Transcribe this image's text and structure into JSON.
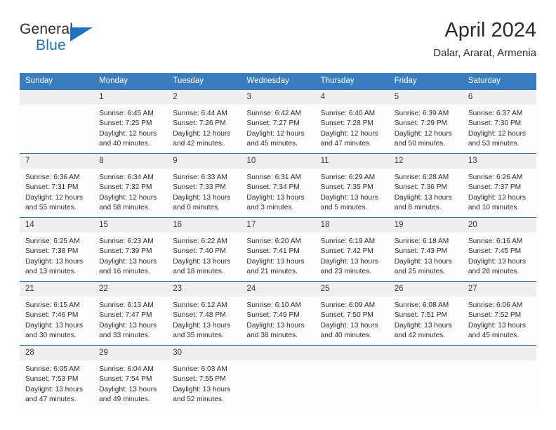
{
  "brand": {
    "word1": "General",
    "word2": "Blue",
    "flag_icon": "triangle-flag-icon",
    "color_primary": "#1f72bd",
    "color_text": "#2b2b2b"
  },
  "header": {
    "month_title": "April 2024",
    "location": "Dalar, Ararat, Armenia"
  },
  "calendar": {
    "accent_color": "#3A7DBF",
    "daynum_bg": "#efefef",
    "weekday_headers": [
      "Sunday",
      "Monday",
      "Tuesday",
      "Wednesday",
      "Thursday",
      "Friday",
      "Saturday"
    ],
    "weeks": [
      [
        {
          "day": "",
          "sunrise": "",
          "sunset": "",
          "daylight_line1": "",
          "daylight_line2": ""
        },
        {
          "day": "1",
          "sunrise": "Sunrise: 6:45 AM",
          "sunset": "Sunset: 7:25 PM",
          "daylight_line1": "Daylight: 12 hours",
          "daylight_line2": "and 40 minutes."
        },
        {
          "day": "2",
          "sunrise": "Sunrise: 6:44 AM",
          "sunset": "Sunset: 7:26 PM",
          "daylight_line1": "Daylight: 12 hours",
          "daylight_line2": "and 42 minutes."
        },
        {
          "day": "3",
          "sunrise": "Sunrise: 6:42 AM",
          "sunset": "Sunset: 7:27 PM",
          "daylight_line1": "Daylight: 12 hours",
          "daylight_line2": "and 45 minutes."
        },
        {
          "day": "4",
          "sunrise": "Sunrise: 6:40 AM",
          "sunset": "Sunset: 7:28 PM",
          "daylight_line1": "Daylight: 12 hours",
          "daylight_line2": "and 47 minutes."
        },
        {
          "day": "5",
          "sunrise": "Sunrise: 6:39 AM",
          "sunset": "Sunset: 7:29 PM",
          "daylight_line1": "Daylight: 12 hours",
          "daylight_line2": "and 50 minutes."
        },
        {
          "day": "6",
          "sunrise": "Sunrise: 6:37 AM",
          "sunset": "Sunset: 7:30 PM",
          "daylight_line1": "Daylight: 12 hours",
          "daylight_line2": "and 53 minutes."
        }
      ],
      [
        {
          "day": "7",
          "sunrise": "Sunrise: 6:36 AM",
          "sunset": "Sunset: 7:31 PM",
          "daylight_line1": "Daylight: 12 hours",
          "daylight_line2": "and 55 minutes."
        },
        {
          "day": "8",
          "sunrise": "Sunrise: 6:34 AM",
          "sunset": "Sunset: 7:32 PM",
          "daylight_line1": "Daylight: 12 hours",
          "daylight_line2": "and 58 minutes."
        },
        {
          "day": "9",
          "sunrise": "Sunrise: 6:33 AM",
          "sunset": "Sunset: 7:33 PM",
          "daylight_line1": "Daylight: 13 hours",
          "daylight_line2": "and 0 minutes."
        },
        {
          "day": "10",
          "sunrise": "Sunrise: 6:31 AM",
          "sunset": "Sunset: 7:34 PM",
          "daylight_line1": "Daylight: 13 hours",
          "daylight_line2": "and 3 minutes."
        },
        {
          "day": "11",
          "sunrise": "Sunrise: 6:29 AM",
          "sunset": "Sunset: 7:35 PM",
          "daylight_line1": "Daylight: 13 hours",
          "daylight_line2": "and 5 minutes."
        },
        {
          "day": "12",
          "sunrise": "Sunrise: 6:28 AM",
          "sunset": "Sunset: 7:36 PM",
          "daylight_line1": "Daylight: 13 hours",
          "daylight_line2": "and 8 minutes."
        },
        {
          "day": "13",
          "sunrise": "Sunrise: 6:26 AM",
          "sunset": "Sunset: 7:37 PM",
          "daylight_line1": "Daylight: 13 hours",
          "daylight_line2": "and 10 minutes."
        }
      ],
      [
        {
          "day": "14",
          "sunrise": "Sunrise: 6:25 AM",
          "sunset": "Sunset: 7:38 PM",
          "daylight_line1": "Daylight: 13 hours",
          "daylight_line2": "and 13 minutes."
        },
        {
          "day": "15",
          "sunrise": "Sunrise: 6:23 AM",
          "sunset": "Sunset: 7:39 PM",
          "daylight_line1": "Daylight: 13 hours",
          "daylight_line2": "and 16 minutes."
        },
        {
          "day": "16",
          "sunrise": "Sunrise: 6:22 AM",
          "sunset": "Sunset: 7:40 PM",
          "daylight_line1": "Daylight: 13 hours",
          "daylight_line2": "and 18 minutes."
        },
        {
          "day": "17",
          "sunrise": "Sunrise: 6:20 AM",
          "sunset": "Sunset: 7:41 PM",
          "daylight_line1": "Daylight: 13 hours",
          "daylight_line2": "and 21 minutes."
        },
        {
          "day": "18",
          "sunrise": "Sunrise: 6:19 AM",
          "sunset": "Sunset: 7:42 PM",
          "daylight_line1": "Daylight: 13 hours",
          "daylight_line2": "and 23 minutes."
        },
        {
          "day": "19",
          "sunrise": "Sunrise: 6:18 AM",
          "sunset": "Sunset: 7:43 PM",
          "daylight_line1": "Daylight: 13 hours",
          "daylight_line2": "and 25 minutes."
        },
        {
          "day": "20",
          "sunrise": "Sunrise: 6:16 AM",
          "sunset": "Sunset: 7:45 PM",
          "daylight_line1": "Daylight: 13 hours",
          "daylight_line2": "and 28 minutes."
        }
      ],
      [
        {
          "day": "21",
          "sunrise": "Sunrise: 6:15 AM",
          "sunset": "Sunset: 7:46 PM",
          "daylight_line1": "Daylight: 13 hours",
          "daylight_line2": "and 30 minutes."
        },
        {
          "day": "22",
          "sunrise": "Sunrise: 6:13 AM",
          "sunset": "Sunset: 7:47 PM",
          "daylight_line1": "Daylight: 13 hours",
          "daylight_line2": "and 33 minutes."
        },
        {
          "day": "23",
          "sunrise": "Sunrise: 6:12 AM",
          "sunset": "Sunset: 7:48 PM",
          "daylight_line1": "Daylight: 13 hours",
          "daylight_line2": "and 35 minutes."
        },
        {
          "day": "24",
          "sunrise": "Sunrise: 6:10 AM",
          "sunset": "Sunset: 7:49 PM",
          "daylight_line1": "Daylight: 13 hours",
          "daylight_line2": "and 38 minutes."
        },
        {
          "day": "25",
          "sunrise": "Sunrise: 6:09 AM",
          "sunset": "Sunset: 7:50 PM",
          "daylight_line1": "Daylight: 13 hours",
          "daylight_line2": "and 40 minutes."
        },
        {
          "day": "26",
          "sunrise": "Sunrise: 6:08 AM",
          "sunset": "Sunset: 7:51 PM",
          "daylight_line1": "Daylight: 13 hours",
          "daylight_line2": "and 42 minutes."
        },
        {
          "day": "27",
          "sunrise": "Sunrise: 6:06 AM",
          "sunset": "Sunset: 7:52 PM",
          "daylight_line1": "Daylight: 13 hours",
          "daylight_line2": "and 45 minutes."
        }
      ],
      [
        {
          "day": "28",
          "sunrise": "Sunrise: 6:05 AM",
          "sunset": "Sunset: 7:53 PM",
          "daylight_line1": "Daylight: 13 hours",
          "daylight_line2": "and 47 minutes."
        },
        {
          "day": "29",
          "sunrise": "Sunrise: 6:04 AM",
          "sunset": "Sunset: 7:54 PM",
          "daylight_line1": "Daylight: 13 hours",
          "daylight_line2": "and 49 minutes."
        },
        {
          "day": "30",
          "sunrise": "Sunrise: 6:03 AM",
          "sunset": "Sunset: 7:55 PM",
          "daylight_line1": "Daylight: 13 hours",
          "daylight_line2": "and 52 minutes."
        },
        {
          "day": "",
          "sunrise": "",
          "sunset": "",
          "daylight_line1": "",
          "daylight_line2": ""
        },
        {
          "day": "",
          "sunrise": "",
          "sunset": "",
          "daylight_line1": "",
          "daylight_line2": ""
        },
        {
          "day": "",
          "sunrise": "",
          "sunset": "",
          "daylight_line1": "",
          "daylight_line2": ""
        },
        {
          "day": "",
          "sunrise": "",
          "sunset": "",
          "daylight_line1": "",
          "daylight_line2": ""
        }
      ]
    ]
  }
}
